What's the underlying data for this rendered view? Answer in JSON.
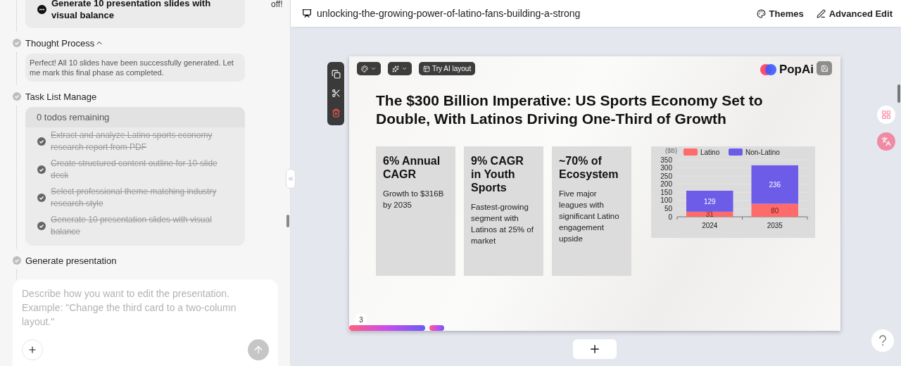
{
  "top_note": "off!",
  "chat": {
    "steps": [
      {
        "kind": "card",
        "text": "Generate 10 presentation slides with visual balance"
      },
      {
        "kind": "thought",
        "title": "Thought Process",
        "expanded": true,
        "text": "Perfect! All 10 slides have been successfully generated. Let me mark this final phase as completed."
      },
      {
        "kind": "todos",
        "title": "Task List Manage",
        "summary": "0 todos remaining",
        "items": [
          {
            "text": "Extract and analyze Latino sports economy research report from PDF",
            "done": true
          },
          {
            "text": "Create structured content outline for 10-slide deck",
            "done": true
          },
          {
            "text": "Select professional theme matching industry research style",
            "done": true
          },
          {
            "text": "Generate 10 presentation slides with visual balance",
            "done": true
          }
        ]
      },
      {
        "kind": "plain",
        "title": "Generate presentation"
      }
    ],
    "composer": {
      "placeholder": "Describe how you want to edit the presentation. Example: \"Change the third card to a two-column layout.\""
    }
  },
  "header": {
    "title": "unlocking-the-growing-power-of-latino-fans-building-a-strong",
    "actions": [
      {
        "kind": "themes",
        "label": "Themes"
      },
      {
        "kind": "edit",
        "label": "Advanced Edit"
      }
    ]
  },
  "slide": {
    "toolbar": [
      {
        "kind": "palette"
      },
      {
        "kind": "sparkle"
      },
      {
        "kind": "layout",
        "label": "Try AI layout"
      }
    ],
    "logo": "PopAi",
    "title": "The $300 Billion Imperative: US Sports Economy Set to Double, With Latinos Driving One-Third of Growth",
    "cards": [
      {
        "heading": "6% Annual CAGR",
        "body": "Growth to $316B by 2035"
      },
      {
        "heading": "9% CAGR in Youth Sports",
        "body": "Fastest-growing segment with Latinos at 25% of market"
      },
      {
        "heading": "~70% of Ecosystem",
        "body": "Five major leagues with significant Latino engagement upside"
      }
    ],
    "chart_data": {
      "type": "bar",
      "stacked": true,
      "ylabel": "($B)",
      "categories": [
        "2024",
        "2035"
      ],
      "series": [
        {
          "name": "Latino",
          "color": "#ff6b6b",
          "values": [
            31,
            80
          ]
        },
        {
          "name": "Non-Latino",
          "color": "#6c5ce7",
          "values": [
            129,
            236
          ]
        }
      ],
      "ylim": [
        0,
        350
      ],
      "yticks": [
        0,
        50,
        100,
        150,
        200,
        250,
        300,
        350
      ],
      "data_labels": true,
      "grid": true,
      "legend": true
    },
    "page_number": "3"
  }
}
